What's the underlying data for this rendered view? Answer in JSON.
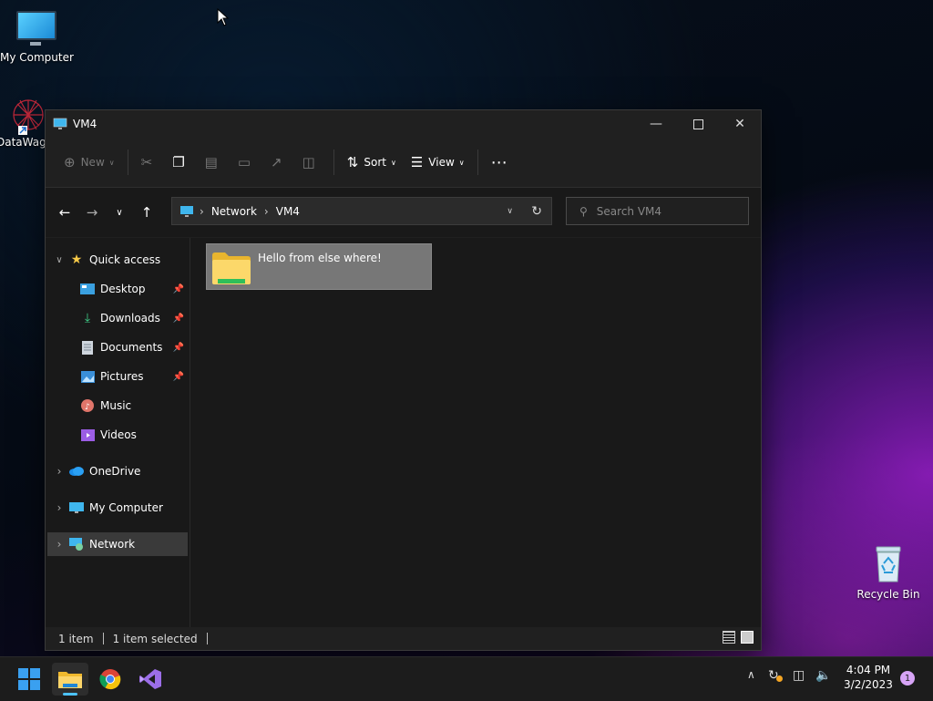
{
  "desktop": {
    "icons": [
      {
        "label": "My Computer"
      },
      {
        "label": "DataWag"
      },
      {
        "label": "Recycle Bin"
      }
    ]
  },
  "window": {
    "title": "VM4",
    "toolbar": {
      "new_label": "New",
      "sort_label": "Sort",
      "view_label": "View"
    },
    "breadcrumb": [
      "Network",
      "VM4"
    ],
    "search_placeholder": "Search VM4",
    "nav": {
      "quick_access": "Quick access",
      "items": [
        {
          "label": "Desktop",
          "pinned": true
        },
        {
          "label": "Downloads",
          "pinned": true
        },
        {
          "label": "Documents",
          "pinned": true
        },
        {
          "label": "Pictures",
          "pinned": true
        },
        {
          "label": "Music",
          "pinned": false
        },
        {
          "label": "Videos",
          "pinned": false
        }
      ],
      "onedrive": "OneDrive",
      "my_computer": "My Computer",
      "network": "Network"
    },
    "folders": [
      {
        "name": "Hello from else where!",
        "selected": true
      }
    ],
    "status": {
      "count": "1 item",
      "selection": "1 item selected"
    }
  },
  "taskbar": {
    "time": "4:04 PM",
    "date": "3/2/2023",
    "notifications": "1"
  },
  "colors": {
    "accent": "#4cc2ff",
    "window_bg": "#202020",
    "selection": "#777777"
  }
}
